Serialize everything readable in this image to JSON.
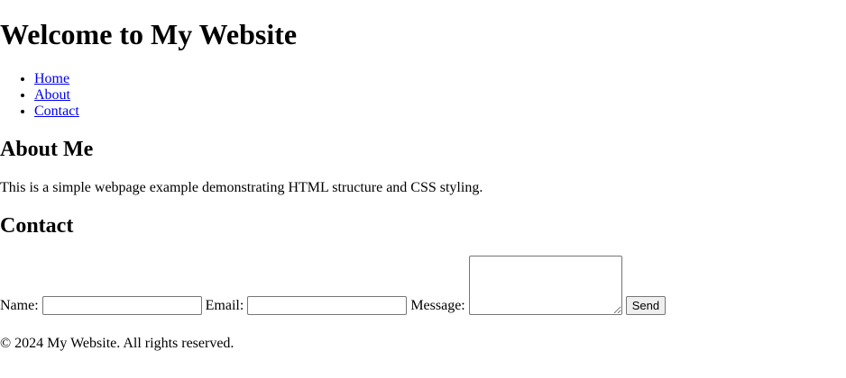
{
  "header": {
    "title": "Welcome to My Website"
  },
  "nav": {
    "items": [
      {
        "label": "Home"
      },
      {
        "label": "About"
      },
      {
        "label": "Contact"
      }
    ]
  },
  "about": {
    "heading": "About Me",
    "text": "This is a simple webpage example demonstrating HTML structure and CSS styling."
  },
  "contact": {
    "heading": "Contact",
    "name_label": "Name:",
    "name_value": "",
    "email_label": "Email:",
    "email_value": "",
    "message_label": "Message:",
    "message_value": "",
    "send_label": "Send"
  },
  "footer": {
    "text": "© 2024 My Website. All rights reserved."
  },
  "colors": {
    "link": "#0000ee",
    "text": "#000000",
    "background": "#ffffff"
  }
}
